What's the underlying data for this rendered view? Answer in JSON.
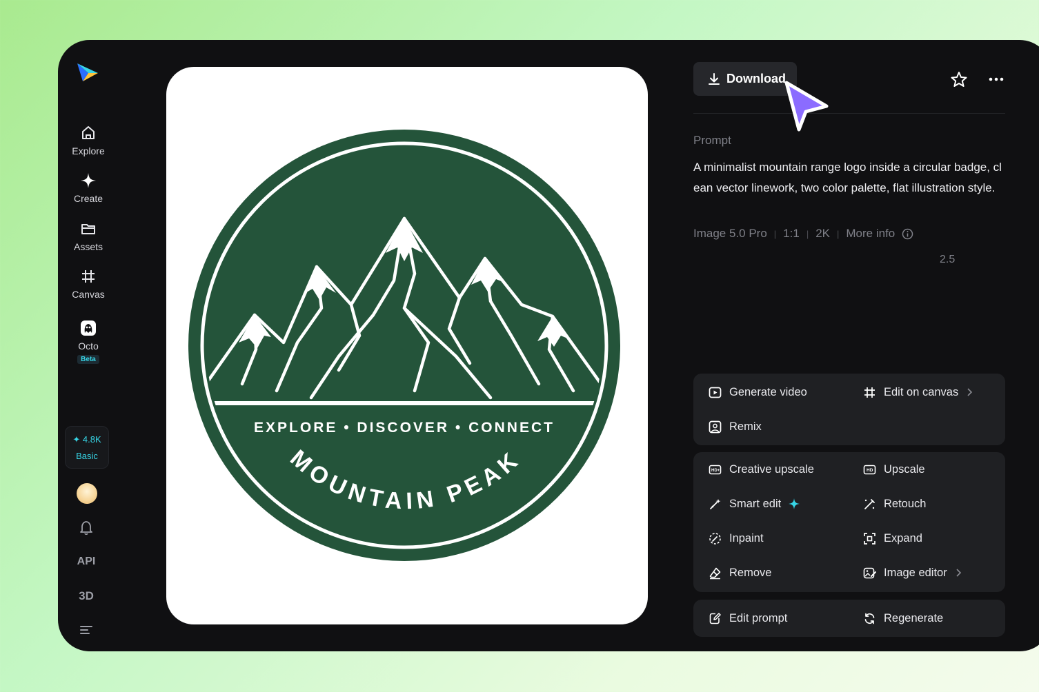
{
  "sidebar": {
    "items": [
      {
        "label": "Explore",
        "icon": "home-icon"
      },
      {
        "label": "Create",
        "icon": "sparkle-icon"
      },
      {
        "label": "Assets",
        "icon": "folder-icon"
      },
      {
        "label": "Canvas",
        "icon": "canvas-icon"
      },
      {
        "label": "Octo",
        "icon": "octo-icon",
        "badge": "Beta"
      }
    ],
    "credits": {
      "amount": "4.8K",
      "plan": "Basic"
    },
    "api_label": "API",
    "three_d_label": "3D"
  },
  "image": {
    "tagline": "EXPLORE • DISCOVER • CONNECT",
    "name": "MOUNTAIN PEAK",
    "colors": {
      "badge_green": "#24543a",
      "white": "#ffffff"
    }
  },
  "panel": {
    "download_label": "Download",
    "prompt_label": "Prompt",
    "prompt_text": "A minimalist mountain range logo inside a circular badge, clean vector linework, two color palette, flat illustration style.",
    "meta": {
      "model": "Image 5.0 Pro",
      "ratio": "1:1",
      "resolution": "2K",
      "more_info": "More info"
    },
    "version": "2.5",
    "groups": [
      [
        {
          "label": "Generate video",
          "icon": "video-play-icon"
        },
        {
          "label": "Edit on canvas",
          "icon": "canvas-icon",
          "chevron": true
        },
        {
          "label": "Remix",
          "icon": "remix-icon"
        }
      ],
      [
        {
          "label": "Creative upscale",
          "icon": "hd-plus-icon"
        },
        {
          "label": "Upscale",
          "icon": "hd-icon"
        },
        {
          "label": "Smart edit",
          "icon": "magic-wand-icon",
          "sparkle": true
        },
        {
          "label": "Retouch",
          "icon": "retouch-icon"
        },
        {
          "label": "Inpaint",
          "icon": "inpaint-icon"
        },
        {
          "label": "Expand",
          "icon": "expand-icon"
        },
        {
          "label": "Remove",
          "icon": "eraser-icon"
        },
        {
          "label": "Image editor",
          "icon": "image-editor-icon",
          "chevron": true
        }
      ],
      [
        {
          "label": "Edit prompt",
          "icon": "edit-prompt-icon"
        },
        {
          "label": "Regenerate",
          "icon": "regenerate-icon"
        }
      ]
    ]
  },
  "colors": {
    "accent_cyan": "#37d5e6",
    "cursor_purple": "#8b6cff",
    "panel_bg": "#101012"
  }
}
